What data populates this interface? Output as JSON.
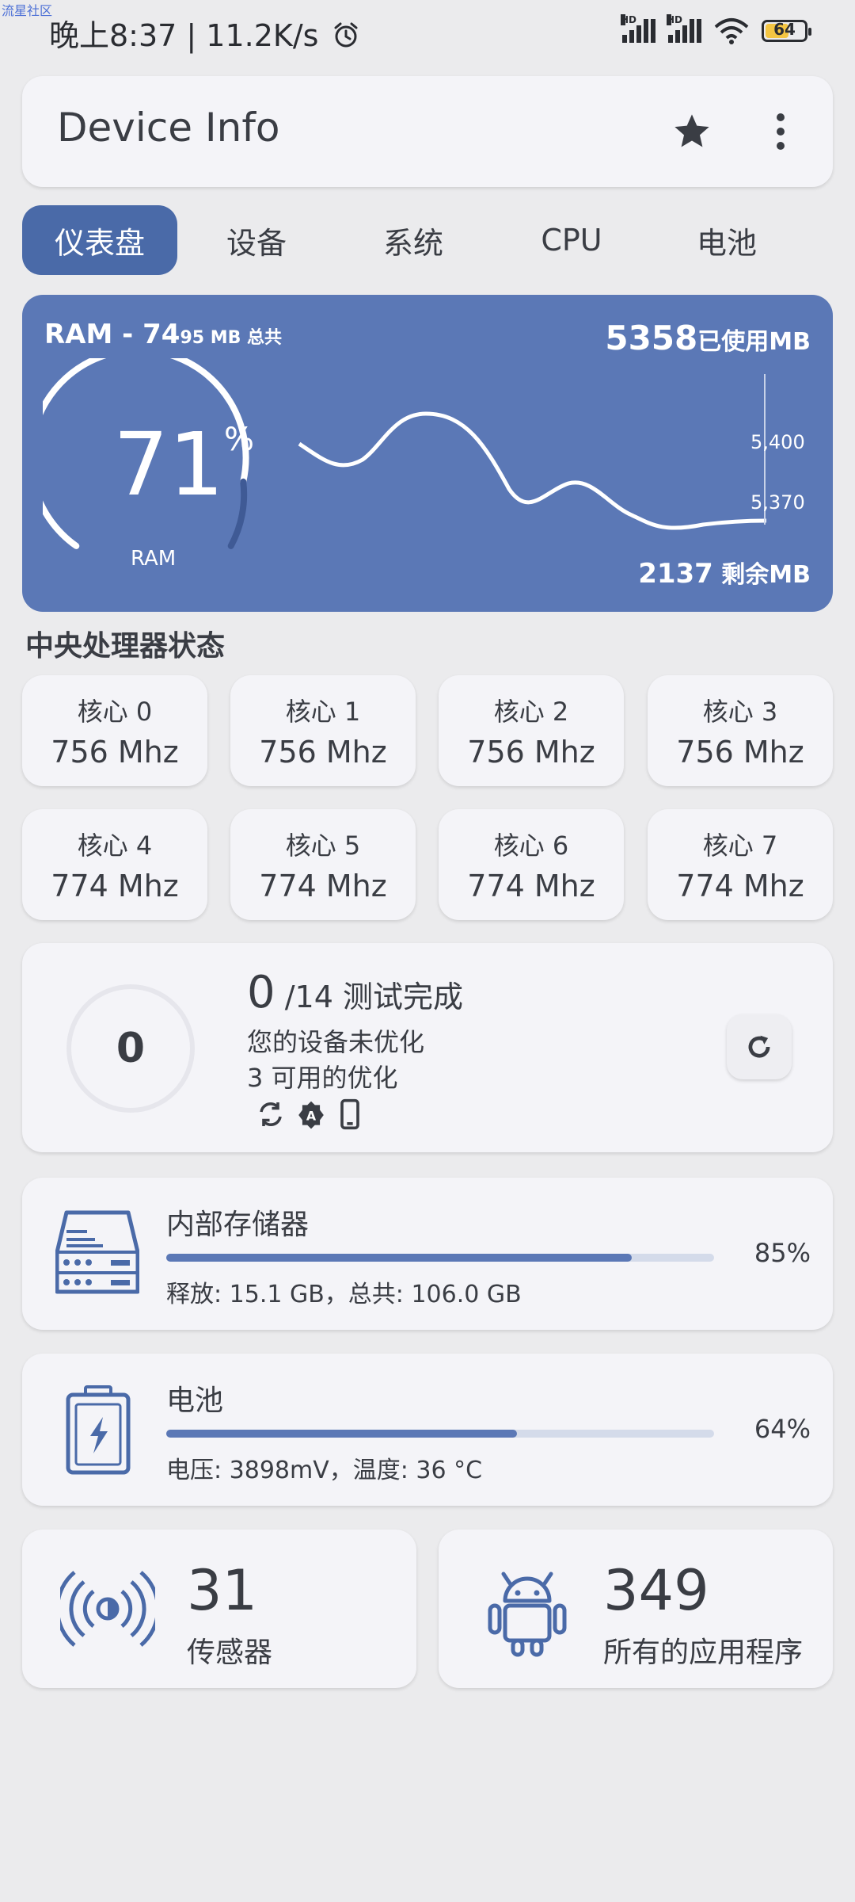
{
  "watermark": "流星社区",
  "status_bar": {
    "time_speed": "晚上8:37 | 11.2K/s",
    "sim1": "HD",
    "sim2": "HD",
    "battery": "64",
    "battery_level": 0.64
  },
  "header": {
    "title": "Device Info"
  },
  "tabs": [
    {
      "label": "仪表盘",
      "active": true
    },
    {
      "label": "设备"
    },
    {
      "label": "系统"
    },
    {
      "label": "CPU"
    },
    {
      "label": "电池"
    }
  ],
  "ram": {
    "total_prefix": "RAM - 74",
    "total_suffix": "95 MB 总共",
    "used_value": "5358",
    "used_unit": "已使用MB",
    "free_value": "2137",
    "free_unit": " 剩余MB",
    "percent": "71",
    "percent_sign": "%",
    "label": "RAM",
    "ticks": [
      "5,400",
      "5,370"
    ]
  },
  "cpu": {
    "title": "中央处理器状态",
    "cores": [
      {
        "name": "核心 0",
        "freq": "756 Mhz"
      },
      {
        "name": "核心 1",
        "freq": "756 Mhz"
      },
      {
        "name": "核心 2",
        "freq": "756 Mhz"
      },
      {
        "name": "核心 3",
        "freq": "756 Mhz"
      },
      {
        "name": "核心 4",
        "freq": "774 Mhz"
      },
      {
        "name": "核心 5",
        "freq": "774 Mhz"
      },
      {
        "name": "核心 6",
        "freq": "774 Mhz"
      },
      {
        "name": "核心 7",
        "freq": "774 Mhz"
      }
    ]
  },
  "test": {
    "score": "0",
    "done": "0",
    "total": " /14 测试完成",
    "line1": "您的设备未优化",
    "line2": "3 可用的优化"
  },
  "storage": {
    "title": "内部存储器",
    "detail": "释放: 15.1 GB，总共: 106.0 GB",
    "percent": "85%",
    "level": 0.85
  },
  "battery": {
    "title": "电池",
    "detail": "电压: 3898mV，温度: 36 °C",
    "percent": "64%",
    "level": 0.64
  },
  "sensors": {
    "count": "31",
    "label": "传感器"
  },
  "apps": {
    "count": "349",
    "label": "所有的应用程序"
  },
  "colors": {
    "accent": "#5b78b6",
    "tab_active": "#4a6aa8",
    "background": "#ebebed"
  }
}
